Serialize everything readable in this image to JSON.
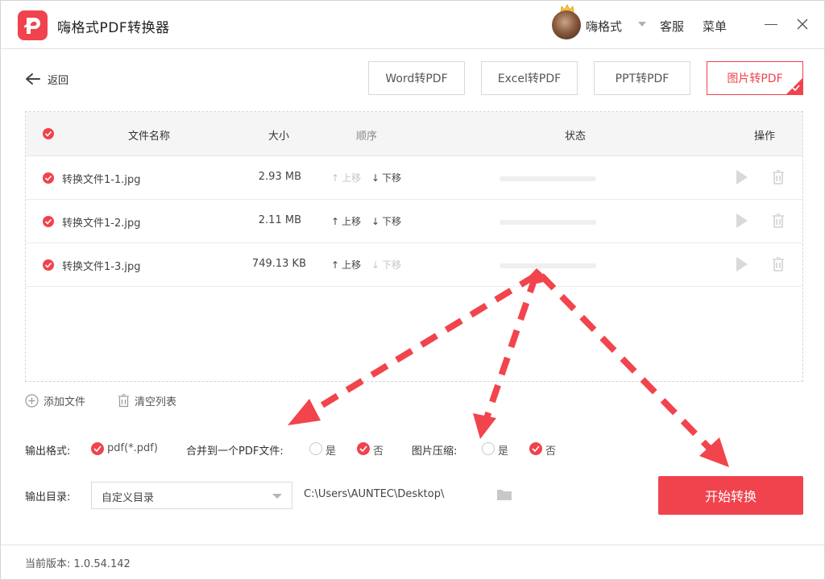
{
  "app": {
    "title": "嗨格式PDF转换器",
    "user_name": "嗨格式",
    "service": "客服",
    "menu": "菜单"
  },
  "nav": {
    "back_label": "返回"
  },
  "tabs": [
    {
      "label": "Word转PDF",
      "active": false
    },
    {
      "label": "Excel转PDF",
      "active": false
    },
    {
      "label": "PPT转PDF",
      "active": false
    },
    {
      "label": "图片转PDF",
      "active": true
    }
  ],
  "table": {
    "headers": {
      "name": "文件名称",
      "size": "大小",
      "order": "顺序",
      "status": "状态",
      "action": "操作"
    },
    "rows": [
      {
        "name": "转换文件1-1.jpg",
        "size": "2.93 MB",
        "up": "上移",
        "down": "下移",
        "up_enabled": false,
        "down_enabled": true,
        "progress": 0
      },
      {
        "name": "转换文件1-2.jpg",
        "size": "2.11 MB",
        "up": "上移",
        "down": "下移",
        "up_enabled": true,
        "down_enabled": true,
        "progress": 0
      },
      {
        "name": "转换文件1-3.jpg",
        "size": "749.13 KB",
        "up": "上移",
        "down": "下移",
        "up_enabled": true,
        "down_enabled": false,
        "progress": 0
      }
    ]
  },
  "actions": {
    "add_file": "添加文件",
    "clear_list": "清空列表"
  },
  "options": {
    "format_label": "输出格式:",
    "format_value": "pdf(*.pdf)",
    "merge_label": "合并到一个PDF文件:",
    "merge_yes": "是",
    "merge_no": "否",
    "compress_label": "图片压缩:",
    "compress_yes": "是",
    "compress_no": "否"
  },
  "output": {
    "dir_label": "输出目录:",
    "dir_select": "自定义目录",
    "path": "C:\\Users\\AUNTEC\\Desktop\\",
    "start_button": "开始转换"
  },
  "footer": {
    "version": "当前版本: 1.0.54.142"
  },
  "colors": {
    "accent": "#f0434d",
    "annotation": "#f2444c"
  }
}
